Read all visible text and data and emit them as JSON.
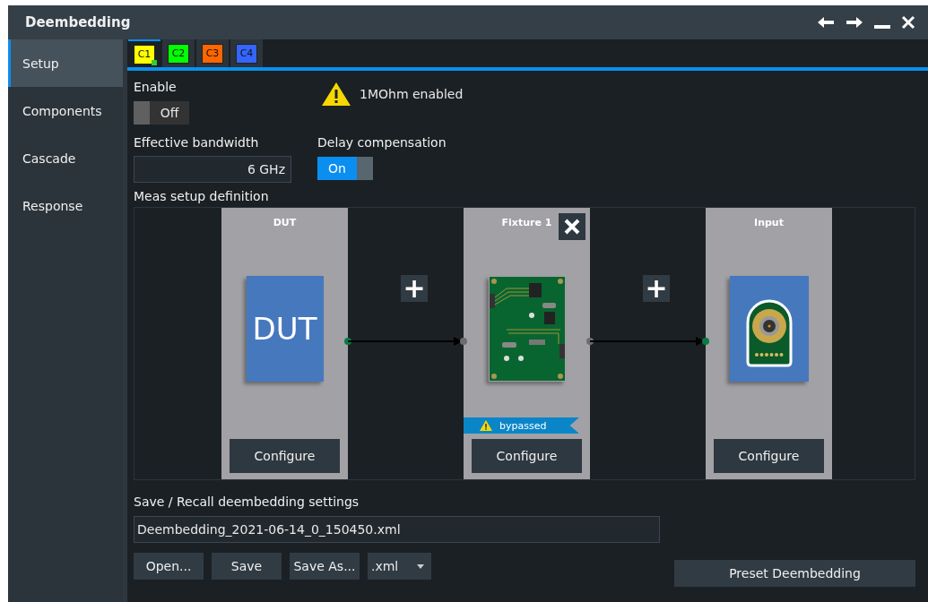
{
  "window": {
    "title": "Deembedding",
    "controls": [
      {
        "kind": "back"
      },
      {
        "kind": "forward"
      },
      {
        "kind": "minimize"
      },
      {
        "kind": "close"
      }
    ]
  },
  "sidebar": {
    "items": [
      {
        "label": "Setup",
        "selected": true
      },
      {
        "label": "Components",
        "selected": false
      },
      {
        "label": "Cascade",
        "selected": false
      },
      {
        "label": "Response",
        "selected": false
      }
    ]
  },
  "channel_tabs": [
    {
      "label": "C1",
      "color": "#ffff00",
      "selected": true,
      "marked": true
    },
    {
      "label": "C2",
      "color": "#00ff00",
      "selected": false,
      "marked": false
    },
    {
      "label": "C3",
      "color": "#ff6600",
      "selected": false,
      "marked": false
    },
    {
      "label": "C4",
      "color": "#3366ff",
      "selected": false,
      "marked": false
    }
  ],
  "enable": {
    "label": "Enable",
    "on": false,
    "text": "Off"
  },
  "warning": {
    "text": "1MOhm enabled"
  },
  "bandwidth": {
    "label": "Effective bandwidth",
    "value": "6 GHz"
  },
  "delay_compensation": {
    "label": "Delay compensation",
    "on": true,
    "text": "On"
  },
  "meas_setup": {
    "label": "Meas setup definition",
    "add_label": "+",
    "components": [
      {
        "kind": "dut",
        "title": "DUT",
        "image_text": "DUT",
        "removable": false,
        "bypassed": false,
        "button": "Configure"
      },
      {
        "kind": "fixture",
        "title": "Fixture 1",
        "removable": true,
        "bypassed": true,
        "badge": "bypassed",
        "button": "Configure"
      },
      {
        "kind": "input",
        "title": "Input",
        "removable": false,
        "bypassed": false,
        "button": "Configure"
      }
    ]
  },
  "save_recall": {
    "label": "Save / Recall deembedding settings",
    "filename": "Deembedding_2021-06-14_0_150450.xml",
    "buttons": [
      "Open...",
      "Save",
      "Save As..."
    ],
    "format": ".xml",
    "preset_button": "Preset Deembedding"
  }
}
